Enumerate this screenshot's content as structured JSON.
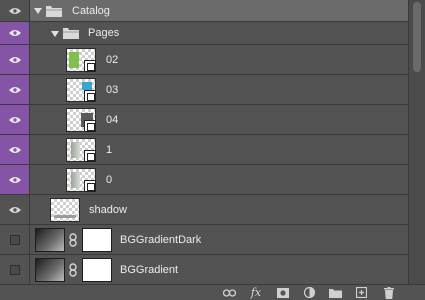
{
  "layers_panel": {
    "groups": [
      {
        "name": "Catalog",
        "expanded": true
      },
      {
        "name": "Pages",
        "expanded": true
      }
    ],
    "pages": [
      {
        "name": "02",
        "visible": true
      },
      {
        "name": "03",
        "visible": true
      },
      {
        "name": "04",
        "visible": true
      },
      {
        "name": "1",
        "visible": true
      },
      {
        "name": "0",
        "visible": true
      }
    ],
    "shadow": {
      "name": "shadow",
      "visible": true
    },
    "backgrounds": [
      {
        "name": "BGGradientDark",
        "visible": false
      },
      {
        "name": "BGGradient",
        "visible": false
      }
    ]
  },
  "footer": {
    "fx_label": "fx",
    "icons": [
      "link-layers-icon",
      "fx-icon",
      "add-mask-icon",
      "adjustment-layer-icon",
      "new-group-icon",
      "new-layer-icon",
      "trash-icon"
    ]
  },
  "colors": {
    "accent_purple": "#8554a6",
    "panel_bg": "#535353",
    "selected_row": "#6b6b6b"
  }
}
